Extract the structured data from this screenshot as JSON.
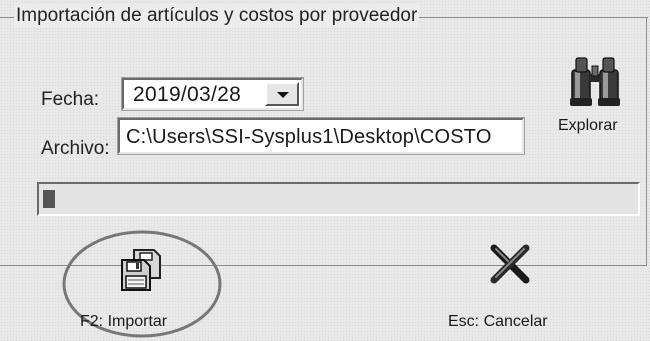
{
  "group": {
    "title": "Importación de artículos y costos por proveedor"
  },
  "fecha": {
    "label": "Fecha:",
    "value": "2019/03/28"
  },
  "archivo": {
    "label": "Archivo:",
    "value": "C:\\Users\\SSI-Sysplus1\\Desktop\\COSTO"
  },
  "explorar": {
    "label": "Explorar",
    "icon": "binoculars-icon"
  },
  "progress": {
    "fraction": 0.02
  },
  "buttons": {
    "importar": {
      "label": "F2: Importar",
      "icon": "import-disk-icon"
    },
    "cancelar": {
      "label": "Esc: Cancelar",
      "icon": "x-cancel-icon"
    }
  }
}
